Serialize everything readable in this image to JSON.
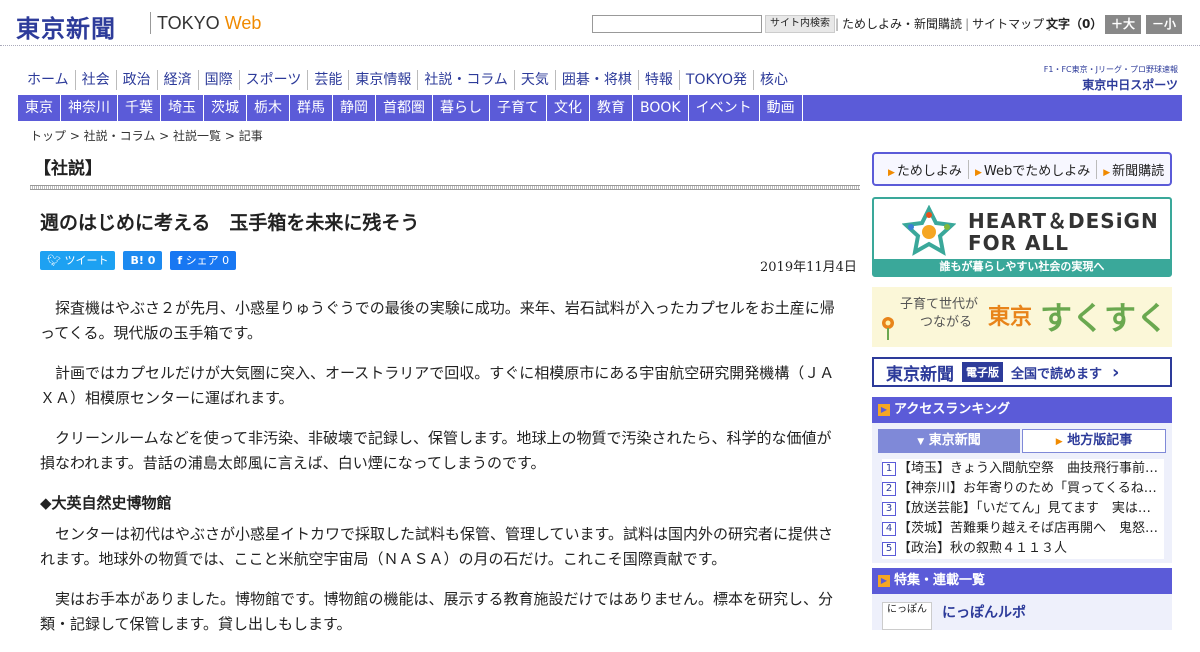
{
  "header": {
    "logo": "東京新聞",
    "logo_sub": "TOKYO",
    "logo_web": "Web",
    "search_button": "サイト内検索",
    "links": [
      "ためしよみ・新聞購読",
      "サイトマップ"
    ],
    "font_size_label": "文字（0）",
    "size_plus": "＋大",
    "size_minus": "－小"
  },
  "nav_main": [
    "ホーム",
    "社会",
    "政治",
    "経済",
    "国際",
    "スポーツ",
    "芸能",
    "東京情報",
    "社説・コラム",
    "天気",
    "囲碁・将棋",
    "特報",
    "TOKYO発",
    "核心"
  ],
  "chunichi": {
    "line1": "F1・FC東京・Jリーグ・プロ野球速報",
    "line2": "東京中日スポーツ"
  },
  "nav_sub": [
    "東京",
    "神奈川",
    "千葉",
    "埼玉",
    "茨城",
    "栃木",
    "群馬",
    "静岡",
    "首都圏",
    "暮らし",
    "子育て",
    "文化",
    "教育",
    "BOOK",
    "イベント",
    "動画"
  ],
  "breadcrumb": "トップ > 社説・コラム > 社説一覧 > 記事",
  "section_title": "【社説】",
  "article": {
    "title": "週のはじめに考える　玉手箱を未来に残そう",
    "date": "2019年11月4日",
    "social": {
      "tweet": "ツイート",
      "hatena": "B!  0",
      "share": "シェア  0"
    },
    "paragraphs": [
      "探査機はやぶさ２が先月、小惑星りゅうぐうでの最後の実験に成功。来年、岩石試料が入ったカプセルをお土産に帰ってくる。現代版の玉手箱です。",
      "計画ではカプセルだけが大気圏に突入、オーストラリアで回収。すぐに相模原市にある宇宙航空研究開発機構（ＪＡＸＡ）相模原センターに運ばれます。",
      "クリーンルームなどを使って非汚染、非破壊で記録し、保管します。地球上の物質で汚染されたら、科学的な価値が損なわれます。昔話の浦島太郎風に言えば、白い煙になってしまうのです。"
    ],
    "subheading": "◆大英自然史博物館",
    "paragraphs2": [
      "センターは初代はやぶさが小惑星イトカワで採取した試料も保管、管理しています。試料は国内外の研究者に提供されます。地球外の物質では、ここと米航空宇宙局（ＮＡＳＡ）の月の石だけ。これこそ国際貢献です。",
      "実はお手本がありました。博物館です。博物館の機能は、展示する教育施設だけではありません。標本を研究し、分類・記録して保管します。貸し出しもします。"
    ]
  },
  "sidebar": {
    "links": [
      "ためしよみ",
      "Webでためしよみ",
      "新聞購読"
    ],
    "heart_line1": "HEART＆DESiGN",
    "heart_line2": "FOR ALL",
    "heart_caption": "誰もが暮らしやすい社会の実現へ",
    "sukusuku_line1": "子育て世代が",
    "sukusuku_line2": "つながる",
    "sukusuku_tokyo": "東京",
    "sukusuku_main": "すくすく",
    "epaper_logo": "東京新聞",
    "epaper_badge": "電子版",
    "epaper_text": "全国で読めます",
    "ranking_title": "アクセスランキング",
    "ranking_tabs": [
      "東京新聞",
      "地方版記事"
    ],
    "ranking": [
      {
        "num": "1",
        "text": "【埼玉】きょう入間航空祭　曲技飛行事前…"
      },
      {
        "num": "2",
        "text": "【神奈川】お年寄りのため「買ってくるね…"
      },
      {
        "num": "3",
        "text": "【放送芸能】「いだてん」見てます　実は…"
      },
      {
        "num": "4",
        "text": "【茨城】苦難乗り越えそば店再開へ　鬼怒…"
      },
      {
        "num": "5",
        "text": "【政治】秋の叙勲４１１３人"
      }
    ],
    "feature_title": "特集・連載一覧",
    "feature_item": "にっぽんルポ",
    "feature_thumb": "にっぽん"
  },
  "colors": {
    "nav_bar": "#5b5bd8",
    "brand": "#2d3b9a",
    "accent": "#f08a00"
  }
}
